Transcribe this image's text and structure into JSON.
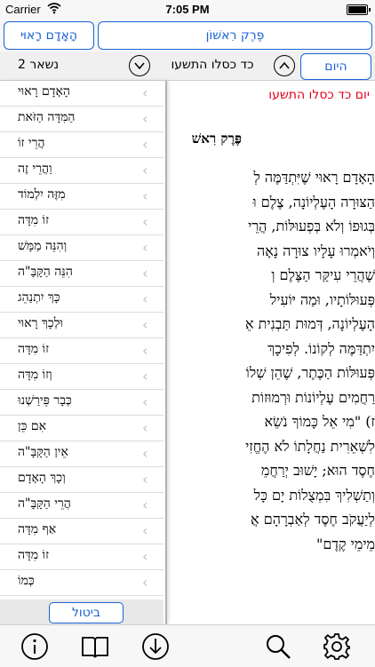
{
  "status": {
    "carrier": "Carrier",
    "time": "7:05 PM"
  },
  "header": {
    "chapter_button": "הָאָדָם רָאוּי",
    "perek_button": "פֶּרֶק רִאשׁוֹן"
  },
  "datebar": {
    "remaining": "נשאר 2",
    "date": "כד כסלו התשעו",
    "today_button": "היום"
  },
  "reader": {
    "day_title": "יום כד כסלו התשעו",
    "chapter_title": "פֶּרֶק רִאשׁ",
    "lines": [
      "הָאָדָם רָאוּי שֶׁיִּתְדַּמֶּה לְ",
      "הַצּוּרָה הָעֶלְיוֹנָה, צֶלֶם וּ",
      "בְּגוּפוֹ וְלֹא בְּפְעוּלּוֹת, הֲרֵי",
      "וְיֹאמְרוּ עָלָיו צוּרָה נָאָה",
      "שֶׁהֲרֵי עִיקַּר הַצֶּלֶם וְ",
      "פְּעוּלּוֹתָיו, וּמַה יּוֹעִיל",
      "הָעֶלְיוֹנָה, דְּמוּת תַּבְנִית אֵ",
      "יִתְדַּמֶּה לְקוֹנוֹ. לְפִיכָךְ",
      "פְּעוּלּוֹת הַכֶּתֶר, שֶׁהֵן שְׁלוֹ",
      "רַחֲמִים עֶלְיוֹנוֹת וּרְמוּזוֹת",
      "ז) \"מִי אֵל כָּמוֹךָ נֹשֵׂא",
      "לִשְׁאֵרִית נַחֲלָתוֹ לֹא הֶחֱזִי",
      "חֶסֶד הוּא; יָשׁוּב יְרַחֲמֵ",
      "וְתַשְׁלִיךְ בִּמְצֻלוֹת יָם כָּל",
      "לְיַעֲקֹב חֶסֶד לְאַבְרָהָם אֲ",
      "מֵימֵי קֶדֶם\""
    ]
  },
  "sidebar": {
    "items": [
      "הָאָדָם רָאוּי",
      "הַמִּדָּה הַזֹּאת",
      "הֲרֵי זוֹ",
      "וַהֲרֵי זֶה",
      "מִזֶּה יִלְמוֹד",
      "זוֹ מִדָּה",
      "וְהִנֵּה מַמָּשׁ",
      "הִנֵּה הַקָּבָּ\"ה",
      "כָּךְ יִתְנַהֵג",
      "וּלְכָךְ רָאוּי",
      "זוֹ מִדָּה",
      "וְזוֹ מִדָּה",
      "כְּבָר פֵּירַשְׁנוּ",
      "אִם כֵּן",
      "אֵין הַקָּבָּ\"ה",
      "וְכָךְ הָאָדָם",
      "הֲרֵי הַקָּבָּ\"ה",
      "אַף מִדָּה",
      "זוֹ מִדָּה",
      "כְּמוֹ"
    ],
    "cancel_button": "ביטול"
  },
  "toolbar": {
    "icons": [
      "info-icon",
      "book-icon",
      "download-icon",
      "search-icon",
      "gear-icon"
    ]
  }
}
